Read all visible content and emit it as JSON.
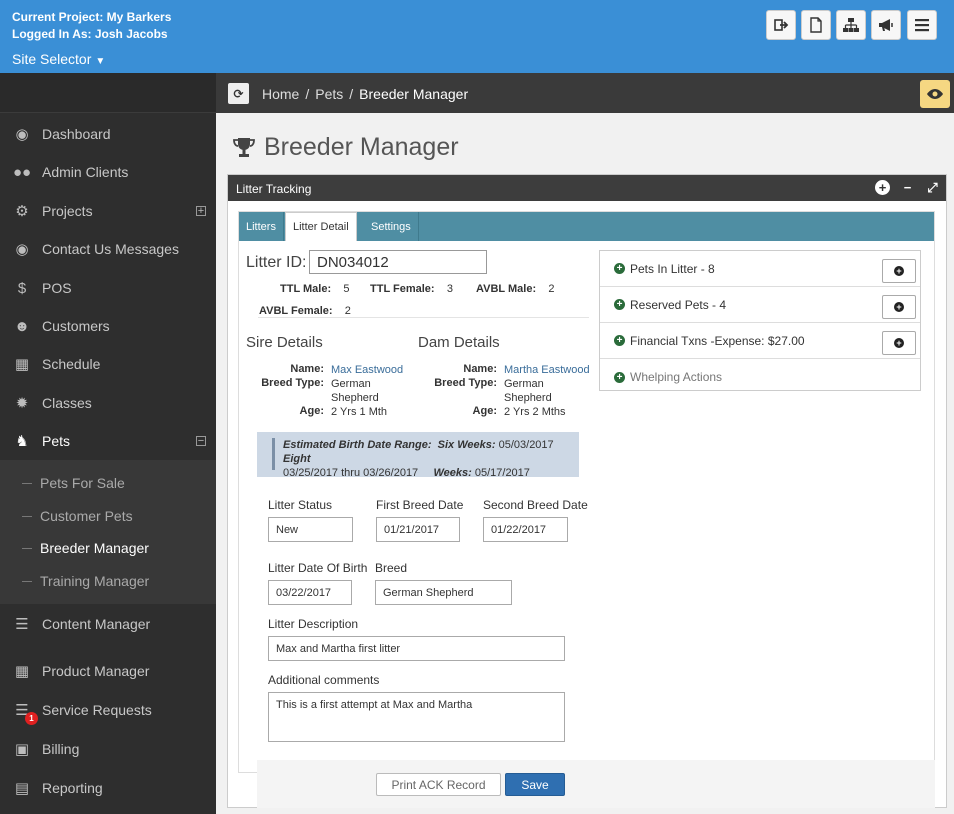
{
  "header": {
    "current_project": "Current Project: My Barkers",
    "logged_in": "Logged In As: Josh Jacobs",
    "site_selector": "Site Selector"
  },
  "sidebar": {
    "items": [
      {
        "label": "Dashboard",
        "icon": "dashboard-icon"
      },
      {
        "label": "Admin Clients",
        "icon": "users-icon"
      },
      {
        "label": "Projects",
        "icon": "gears-icon"
      },
      {
        "label": "Contact Us Messages",
        "icon": "comments-icon"
      },
      {
        "label": "POS",
        "icon": "dollar-icon"
      },
      {
        "label": "Customers",
        "icon": "customer-icon"
      },
      {
        "label": "Schedule",
        "icon": "calendar-icon"
      },
      {
        "label": "Classes",
        "icon": "badge-icon"
      },
      {
        "label": "Pets",
        "icon": "paw-icon"
      },
      {
        "label": "Content Manager",
        "icon": "layers-icon"
      },
      {
        "label": "Product Manager",
        "icon": "barcode-icon"
      },
      {
        "label": "Service Requests",
        "icon": "tasks-icon"
      },
      {
        "label": "Billing",
        "icon": "money-icon"
      },
      {
        "label": "Reporting",
        "icon": "file-icon"
      }
    ],
    "pets_sub": [
      "Pets For Sale",
      "Customer Pets",
      "Breeder Manager",
      "Training Manager"
    ],
    "service_badge": "1"
  },
  "breadcrumb": {
    "home": "Home",
    "pets": "Pets",
    "current": "Breeder Manager"
  },
  "page": {
    "title": "Breeder Manager"
  },
  "panel": {
    "title": "Litter Tracking",
    "tabs": [
      "Litters",
      "Litter Detail",
      "Settings"
    ]
  },
  "litter": {
    "id_label": "Litter ID:",
    "id_value": "DN034012",
    "ttl_male_label": "TTL Male:",
    "ttl_male": "5",
    "ttl_female_label": "TTL Female:",
    "ttl_female": "3",
    "avbl_male_label": "AVBL Male:",
    "avbl_male": "2",
    "avbl_female_label": "AVBL Female:",
    "avbl_female": "2"
  },
  "sire": {
    "title": "Sire Details",
    "name_label": "Name:",
    "name": "Max Eastwood",
    "breed_label": "Breed Type:",
    "breed_1": "German",
    "breed_2": "Shepherd",
    "age_label": "Age:",
    "age": "2 Yrs 1 Mth"
  },
  "dam": {
    "title": "Dam Details",
    "name_label": "Name:",
    "name": "Martha Eastwood",
    "breed_label": "Breed Type:",
    "breed_1": "German",
    "breed_2": "Shepherd",
    "age_label": "Age:",
    "age": "2 Yrs 2 Mths"
  },
  "notice": {
    "label": "Estimated Birth Date Range:",
    "six_weeks_label": "Six Weeks:",
    "six_weeks": "05/03/2017",
    "eight_label": "Eight",
    "range": "03/25/2017 thru 03/26/2017",
    "weeks_label": "Weeks:",
    "eight_weeks": "05/17/2017"
  },
  "form": {
    "litter_status_label": "Litter Status",
    "litter_status": "New",
    "first_breed_label": "First Breed Date",
    "first_breed": "01/21/2017",
    "second_breed_label": "Second Breed Date",
    "second_breed": "01/22/2017",
    "dob_label": "Litter Date Of Birth",
    "dob": "03/22/2017",
    "breed_label": "Breed",
    "breed": "German Shepherd",
    "desc_label": "Litter Description",
    "desc": "Max and Martha first litter",
    "comments_label": "Additional comments",
    "comments": "This is a first attempt at Max and Martha"
  },
  "accordion": {
    "pets_in_litter": "Pets In Litter - 8",
    "reserved": "Reserved Pets - 4",
    "financial": "Financial Txns -Expense: $27.00",
    "whelping": "Whelping Actions"
  },
  "buttons": {
    "print": "Print ACK Record",
    "save": "Save"
  }
}
